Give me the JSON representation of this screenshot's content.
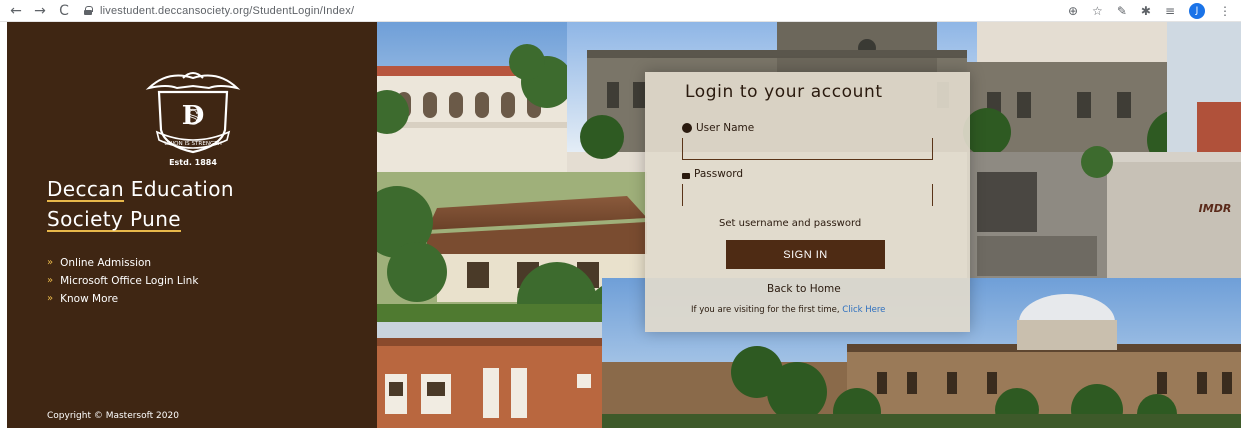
{
  "browser": {
    "url": "livestudent.deccansociety.org/StudentLogin/Index/",
    "back_glyph": "←",
    "forward_glyph": "→",
    "reload_glyph": "C",
    "right_icons": [
      "zoom-icon",
      "star-icon",
      "pen-icon",
      "extensions-icon",
      "reading-list-icon",
      "profile-icon",
      "menu-icon"
    ],
    "zoom_glyph": "⊕",
    "star_glyph": "☆",
    "pen_glyph": "✎",
    "ext_glyph": "✱",
    "list_glyph": "≡",
    "profile_glyph": "J",
    "menu_glyph": "⋮"
  },
  "sidebar": {
    "logo_text_top": "UNION IS STRENGTH",
    "logo_estd": "Estd. 1884",
    "logo_monogram": "DES",
    "brand_line1_a": "Deccan",
    "brand_line1_b": " Education",
    "brand_line2": "Society Pune",
    "links": [
      {
        "label": "Online Admission"
      },
      {
        "label": "Microsoft Office Login Link"
      },
      {
        "label": "Know More"
      }
    ],
    "bullet": "»",
    "copyright": "Copyright © Mastersoft 2020"
  },
  "collage": {
    "building_sign": "IMDR"
  },
  "login": {
    "title": "Login to your account",
    "username_label": "User Name",
    "username_value": "",
    "password_label": "Password",
    "password_value": "",
    "set_credentials": "Set username and password",
    "signin_label": "SIGN IN",
    "back_home": "Back to Home",
    "first_time_text": "If you are visiting for the first time, ",
    "first_time_link": "Click Here"
  },
  "colors": {
    "sidebar_bg": "#3f2613",
    "accent": "#e8b84a",
    "button_bg": "#4e2b14",
    "link": "#2e6fbf"
  }
}
